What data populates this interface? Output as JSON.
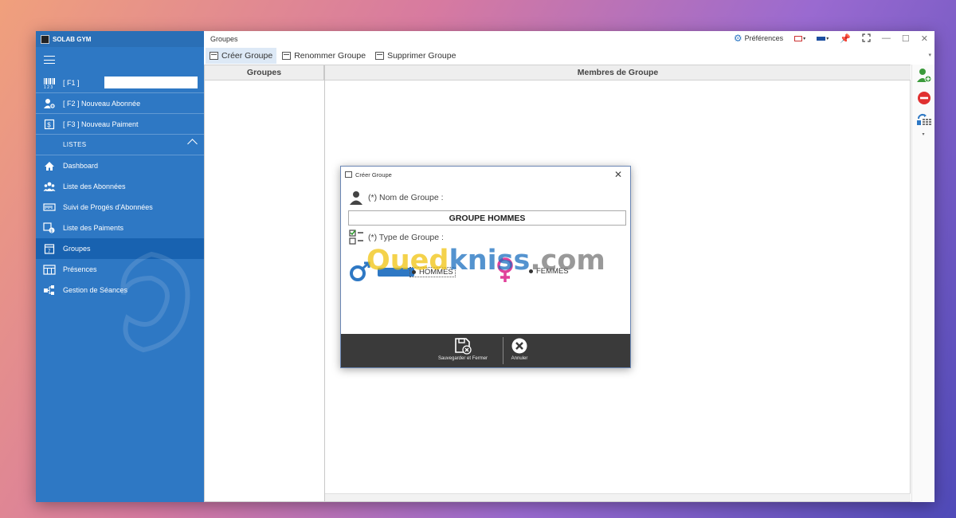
{
  "app": {
    "title": "SOLAB GYM"
  },
  "sidebar": {
    "search_shortcut": "[ F1 ]",
    "search_value": "",
    "actions": [
      {
        "label": "[ F2 ] Nouveau Abonnée",
        "icon": "add-user-icon"
      },
      {
        "label": "[ F3 ] Nouveau Paiment",
        "icon": "payment-icon"
      }
    ],
    "section_label": "LISTES",
    "items": [
      {
        "label": "Dashboard",
        "icon": "home-icon"
      },
      {
        "label": "Liste des Abonnées",
        "icon": "users-icon"
      },
      {
        "label": "Suivi de Progés d'Abonnées",
        "icon": "progress-icon"
      },
      {
        "label": "Liste des Paiments",
        "icon": "payments-list-icon"
      },
      {
        "label": "Groupes",
        "icon": "calendar-icon",
        "active": true
      },
      {
        "label": "Présences",
        "icon": "attendance-icon"
      },
      {
        "label": "Gestion de Séances",
        "icon": "sessions-icon"
      }
    ]
  },
  "main": {
    "page_title": "Groupes",
    "preferences_label": "Préférences",
    "toolbar": {
      "create": "Créer Groupe",
      "rename": "Renommer Groupe",
      "delete": "Supprimer Groupe"
    },
    "columns": {
      "groupes": "Groupes",
      "membres": "Membres de Groupe"
    }
  },
  "dialog": {
    "title": "Créer Groupe",
    "name_label": "(*) Nom de Groupe :",
    "name_value": "GROUPE HOMMES",
    "type_label": "(*) Type de Groupe :",
    "options": {
      "hommes": "HOMMES",
      "femmes": "FEMMES",
      "selected": "hommes"
    },
    "save_label": "Sauvegarder et Fermer",
    "cancel_label": "Annuler"
  },
  "watermark": {
    "part1": "Oued",
    "part2": "kniss",
    "part3": ".com"
  },
  "colors": {
    "sidebar": "#2e78c4",
    "sidebar_active": "#1862b0",
    "footer": "#3a3a3a",
    "female": "#e0409a"
  }
}
